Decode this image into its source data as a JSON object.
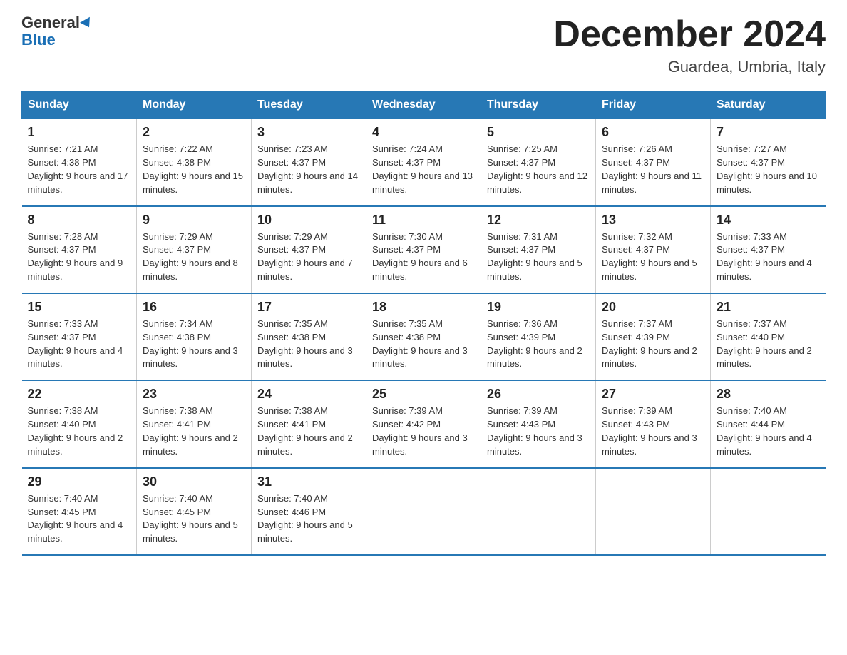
{
  "logo": {
    "line1": "General",
    "line2": "Blue"
  },
  "header": {
    "month": "December 2024",
    "location": "Guardea, Umbria, Italy"
  },
  "days_of_week": [
    "Sunday",
    "Monday",
    "Tuesday",
    "Wednesday",
    "Thursday",
    "Friday",
    "Saturday"
  ],
  "weeks": [
    [
      {
        "day": "1",
        "sunrise": "Sunrise: 7:21 AM",
        "sunset": "Sunset: 4:38 PM",
        "daylight": "Daylight: 9 hours and 17 minutes."
      },
      {
        "day": "2",
        "sunrise": "Sunrise: 7:22 AM",
        "sunset": "Sunset: 4:38 PM",
        "daylight": "Daylight: 9 hours and 15 minutes."
      },
      {
        "day": "3",
        "sunrise": "Sunrise: 7:23 AM",
        "sunset": "Sunset: 4:37 PM",
        "daylight": "Daylight: 9 hours and 14 minutes."
      },
      {
        "day": "4",
        "sunrise": "Sunrise: 7:24 AM",
        "sunset": "Sunset: 4:37 PM",
        "daylight": "Daylight: 9 hours and 13 minutes."
      },
      {
        "day": "5",
        "sunrise": "Sunrise: 7:25 AM",
        "sunset": "Sunset: 4:37 PM",
        "daylight": "Daylight: 9 hours and 12 minutes."
      },
      {
        "day": "6",
        "sunrise": "Sunrise: 7:26 AM",
        "sunset": "Sunset: 4:37 PM",
        "daylight": "Daylight: 9 hours and 11 minutes."
      },
      {
        "day": "7",
        "sunrise": "Sunrise: 7:27 AM",
        "sunset": "Sunset: 4:37 PM",
        "daylight": "Daylight: 9 hours and 10 minutes."
      }
    ],
    [
      {
        "day": "8",
        "sunrise": "Sunrise: 7:28 AM",
        "sunset": "Sunset: 4:37 PM",
        "daylight": "Daylight: 9 hours and 9 minutes."
      },
      {
        "day": "9",
        "sunrise": "Sunrise: 7:29 AM",
        "sunset": "Sunset: 4:37 PM",
        "daylight": "Daylight: 9 hours and 8 minutes."
      },
      {
        "day": "10",
        "sunrise": "Sunrise: 7:29 AM",
        "sunset": "Sunset: 4:37 PM",
        "daylight": "Daylight: 9 hours and 7 minutes."
      },
      {
        "day": "11",
        "sunrise": "Sunrise: 7:30 AM",
        "sunset": "Sunset: 4:37 PM",
        "daylight": "Daylight: 9 hours and 6 minutes."
      },
      {
        "day": "12",
        "sunrise": "Sunrise: 7:31 AM",
        "sunset": "Sunset: 4:37 PM",
        "daylight": "Daylight: 9 hours and 5 minutes."
      },
      {
        "day": "13",
        "sunrise": "Sunrise: 7:32 AM",
        "sunset": "Sunset: 4:37 PM",
        "daylight": "Daylight: 9 hours and 5 minutes."
      },
      {
        "day": "14",
        "sunrise": "Sunrise: 7:33 AM",
        "sunset": "Sunset: 4:37 PM",
        "daylight": "Daylight: 9 hours and 4 minutes."
      }
    ],
    [
      {
        "day": "15",
        "sunrise": "Sunrise: 7:33 AM",
        "sunset": "Sunset: 4:37 PM",
        "daylight": "Daylight: 9 hours and 4 minutes."
      },
      {
        "day": "16",
        "sunrise": "Sunrise: 7:34 AM",
        "sunset": "Sunset: 4:38 PM",
        "daylight": "Daylight: 9 hours and 3 minutes."
      },
      {
        "day": "17",
        "sunrise": "Sunrise: 7:35 AM",
        "sunset": "Sunset: 4:38 PM",
        "daylight": "Daylight: 9 hours and 3 minutes."
      },
      {
        "day": "18",
        "sunrise": "Sunrise: 7:35 AM",
        "sunset": "Sunset: 4:38 PM",
        "daylight": "Daylight: 9 hours and 3 minutes."
      },
      {
        "day": "19",
        "sunrise": "Sunrise: 7:36 AM",
        "sunset": "Sunset: 4:39 PM",
        "daylight": "Daylight: 9 hours and 2 minutes."
      },
      {
        "day": "20",
        "sunrise": "Sunrise: 7:37 AM",
        "sunset": "Sunset: 4:39 PM",
        "daylight": "Daylight: 9 hours and 2 minutes."
      },
      {
        "day": "21",
        "sunrise": "Sunrise: 7:37 AM",
        "sunset": "Sunset: 4:40 PM",
        "daylight": "Daylight: 9 hours and 2 minutes."
      }
    ],
    [
      {
        "day": "22",
        "sunrise": "Sunrise: 7:38 AM",
        "sunset": "Sunset: 4:40 PM",
        "daylight": "Daylight: 9 hours and 2 minutes."
      },
      {
        "day": "23",
        "sunrise": "Sunrise: 7:38 AM",
        "sunset": "Sunset: 4:41 PM",
        "daylight": "Daylight: 9 hours and 2 minutes."
      },
      {
        "day": "24",
        "sunrise": "Sunrise: 7:38 AM",
        "sunset": "Sunset: 4:41 PM",
        "daylight": "Daylight: 9 hours and 2 minutes."
      },
      {
        "day": "25",
        "sunrise": "Sunrise: 7:39 AM",
        "sunset": "Sunset: 4:42 PM",
        "daylight": "Daylight: 9 hours and 3 minutes."
      },
      {
        "day": "26",
        "sunrise": "Sunrise: 7:39 AM",
        "sunset": "Sunset: 4:43 PM",
        "daylight": "Daylight: 9 hours and 3 minutes."
      },
      {
        "day": "27",
        "sunrise": "Sunrise: 7:39 AM",
        "sunset": "Sunset: 4:43 PM",
        "daylight": "Daylight: 9 hours and 3 minutes."
      },
      {
        "day": "28",
        "sunrise": "Sunrise: 7:40 AM",
        "sunset": "Sunset: 4:44 PM",
        "daylight": "Daylight: 9 hours and 4 minutes."
      }
    ],
    [
      {
        "day": "29",
        "sunrise": "Sunrise: 7:40 AM",
        "sunset": "Sunset: 4:45 PM",
        "daylight": "Daylight: 9 hours and 4 minutes."
      },
      {
        "day": "30",
        "sunrise": "Sunrise: 7:40 AM",
        "sunset": "Sunset: 4:45 PM",
        "daylight": "Daylight: 9 hours and 5 minutes."
      },
      {
        "day": "31",
        "sunrise": "Sunrise: 7:40 AM",
        "sunset": "Sunset: 4:46 PM",
        "daylight": "Daylight: 9 hours and 5 minutes."
      },
      {
        "day": "",
        "sunrise": "",
        "sunset": "",
        "daylight": ""
      },
      {
        "day": "",
        "sunrise": "",
        "sunset": "",
        "daylight": ""
      },
      {
        "day": "",
        "sunrise": "",
        "sunset": "",
        "daylight": ""
      },
      {
        "day": "",
        "sunrise": "",
        "sunset": "",
        "daylight": ""
      }
    ]
  ]
}
